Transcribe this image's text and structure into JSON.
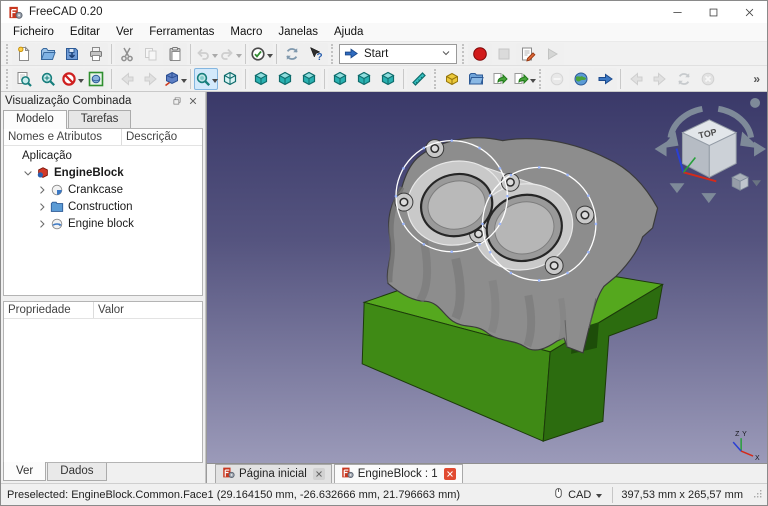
{
  "window": {
    "title": "FreeCAD 0.20",
    "controls": {
      "minimize": "minimize",
      "maximize": "maximize",
      "close": "close"
    }
  },
  "menubar": {
    "items": [
      "Ficheiro",
      "Editar",
      "Ver",
      "Ferramentas",
      "Macro",
      "Janelas",
      "Ajuda"
    ]
  },
  "toolbars": {
    "workbench_selector": {
      "value": "Start",
      "icon": "workbench-start"
    },
    "row1": [
      {
        "type": "grip"
      },
      {
        "name": "new-file",
        "icon": "new-file"
      },
      {
        "name": "open",
        "icon": "open"
      },
      {
        "name": "save",
        "icon": "save"
      },
      {
        "name": "print",
        "icon": "print"
      },
      {
        "type": "sep"
      },
      {
        "name": "cut",
        "icon": "cut"
      },
      {
        "name": "copy",
        "icon": "copy",
        "disabled": true
      },
      {
        "name": "paste",
        "icon": "paste"
      },
      {
        "type": "sep"
      },
      {
        "name": "undo",
        "icon": "undo",
        "disabled": true,
        "dropdown": true
      },
      {
        "name": "redo",
        "icon": "redo",
        "disabled": true,
        "dropdown": true
      },
      {
        "type": "sep"
      },
      {
        "name": "edit-mode",
        "icon": "edit-mode",
        "dropdown": true
      },
      {
        "type": "sep"
      },
      {
        "name": "refresh",
        "icon": "refresh"
      },
      {
        "name": "whats-this",
        "icon": "whats-this"
      },
      {
        "type": "grip"
      },
      {
        "type": "combo"
      },
      {
        "type": "grip"
      },
      {
        "name": "macro-record",
        "icon": "record-macro"
      },
      {
        "name": "macro-stop",
        "icon": "stop-macro",
        "disabled": true
      },
      {
        "name": "macro-edit",
        "icon": "edit-macro"
      },
      {
        "name": "macro-run",
        "icon": "run-macro",
        "disabled": true
      }
    ],
    "row2": [
      {
        "type": "grip"
      },
      {
        "name": "fit-all",
        "icon": "fit-all"
      },
      {
        "name": "fit-selection",
        "icon": "fit-selection"
      },
      {
        "name": "clipping",
        "icon": "clipping",
        "dropdown": true
      },
      {
        "name": "draw-style",
        "icon": "draw-style"
      },
      {
        "type": "sep"
      },
      {
        "name": "nav-back",
        "icon": "nav-back",
        "disabled": true
      },
      {
        "name": "nav-forward",
        "icon": "nav-forward",
        "disabled": true
      },
      {
        "name": "isometric-view",
        "icon": "iso-view",
        "dropdown": true
      },
      {
        "type": "sep"
      },
      {
        "name": "zoom-box",
        "icon": "zoom-box",
        "dropdown": true,
        "highlighted": true
      },
      {
        "name": "view-axonometric",
        "icon": "axonometric"
      },
      {
        "type": "sep"
      },
      {
        "name": "view-front",
        "icon": "view-cube"
      },
      {
        "name": "view-top",
        "icon": "view-cube"
      },
      {
        "name": "view-right",
        "icon": "view-cube"
      },
      {
        "type": "sep"
      },
      {
        "name": "view-rear",
        "icon": "view-cube"
      },
      {
        "name": "view-bottom",
        "icon": "view-cube"
      },
      {
        "name": "view-left",
        "icon": "view-cube"
      },
      {
        "type": "sep"
      },
      {
        "name": "measure",
        "icon": "measure"
      },
      {
        "type": "grip"
      },
      {
        "name": "create-part",
        "icon": "create-part"
      },
      {
        "name": "create-group",
        "icon": "create-group"
      },
      {
        "name": "make-link",
        "icon": "make-link"
      },
      {
        "name": "make-sub-link",
        "icon": "make-link",
        "dropdown": true
      },
      {
        "type": "grip"
      },
      {
        "name": "web-stop",
        "icon": "web-stop",
        "disabled": true
      },
      {
        "name": "web-home",
        "icon": "web-home"
      },
      {
        "name": "web-forward",
        "icon": "web-forward"
      },
      {
        "type": "sep"
      },
      {
        "name": "browser-back",
        "icon": "nav-back",
        "disabled": true
      },
      {
        "name": "browser-forward",
        "icon": "nav-forward",
        "disabled": true
      },
      {
        "name": "browser-refresh",
        "icon": "refresh",
        "disabled": true
      },
      {
        "name": "browser-stop",
        "icon": "stop-gray",
        "disabled": true
      },
      {
        "type": "overflow",
        "label": "»"
      }
    ]
  },
  "combined_view": {
    "title": "Visualização Combinada",
    "tabs": [
      {
        "label": "Modelo",
        "active": true
      },
      {
        "label": "Tarefas",
        "active": false
      }
    ],
    "tree": {
      "columns": [
        "Nomes e Atributos",
        "Descrição"
      ],
      "items": [
        {
          "label": "Aplicação",
          "level": 0
        },
        {
          "label": "EngineBlock",
          "level": 1,
          "icon": "freecad-document",
          "twisty": "down",
          "bold": true
        },
        {
          "label": "Crankcase",
          "level": 2,
          "icon": "boolean-cut",
          "twisty": "right"
        },
        {
          "label": "Construction",
          "level": 2,
          "icon": "group-folder",
          "twisty": "right"
        },
        {
          "label": "Engine block",
          "level": 2,
          "icon": "boolean-common",
          "twisty": "right"
        }
      ]
    },
    "property_panel": {
      "columns": [
        "Propriedade",
        "Valor"
      ],
      "rows": []
    },
    "bottom_tabs": [
      {
        "label": "Ver",
        "active": true
      },
      {
        "label": "Dados",
        "active": false
      }
    ]
  },
  "viewport": {
    "nav_cube": {
      "top_face_label": "TOP"
    },
    "axis_labels": {
      "z": "Z",
      "y": "Y",
      "x": "X"
    },
    "background": {
      "top": "#3a3969",
      "bottom": "#9b9ab9"
    },
    "model": {
      "crankcase_color": "#8d8d8d",
      "engine_block_color": "#4f9c1c",
      "construction_color": "#ffffff"
    },
    "document_tabs": [
      {
        "label": "Página inicial",
        "active": false
      },
      {
        "label": "EngineBlock : 1",
        "active": true
      }
    ]
  },
  "statusbar": {
    "message": "Preselected: EngineBlock.Common.Face1 (29.164150 mm, -26.632666 mm, 21.796663 mm)",
    "navigation_style": "CAD",
    "viewport_size": "397,53 mm x 265,57 mm"
  }
}
